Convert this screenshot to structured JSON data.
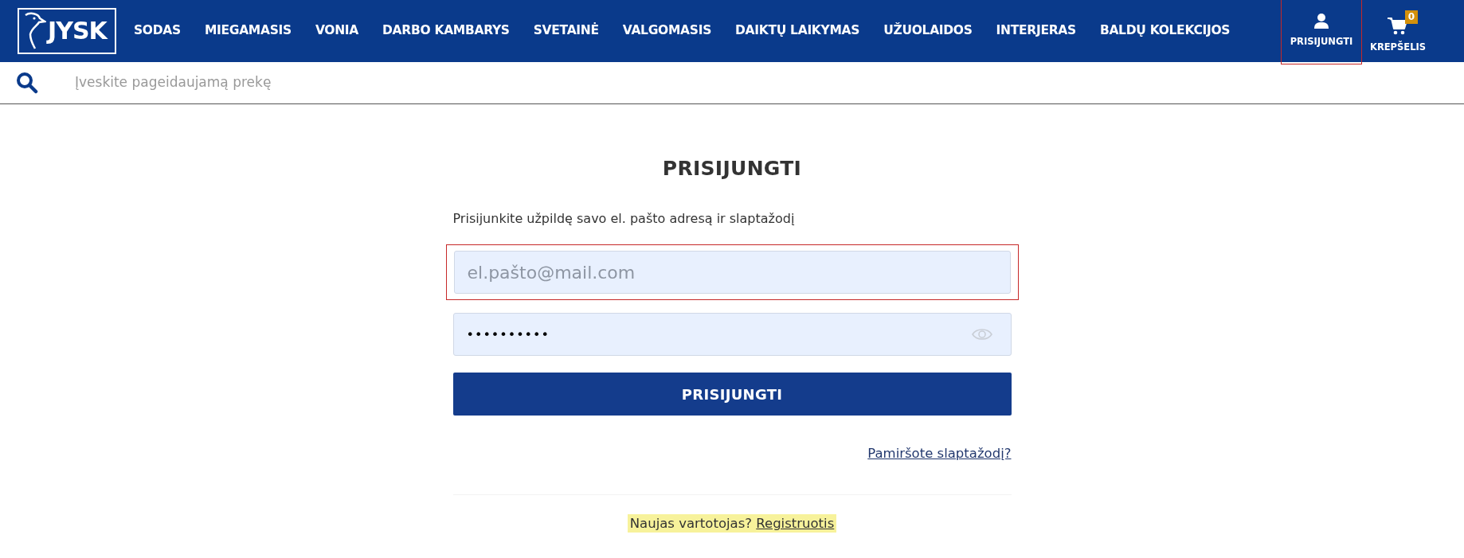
{
  "header": {
    "logo": "JYSK",
    "nav": [
      "SODAS",
      "MIEGAMASIS",
      "VONIA",
      "DARBO KAMBARYS",
      "SVETAINĖ",
      "VALGOMASIS",
      "DAIKTŲ LAIKYMAS",
      "UŽUOLAIDOS",
      "INTERJERAS",
      "BALDŲ KOLEKCIJOS"
    ],
    "account": {
      "label": "PRISIJUNGTI",
      "highlighted": true
    },
    "cart": {
      "label": "KREPŠELIS",
      "count": "0"
    }
  },
  "search": {
    "placeholder": "Įveskite pageidaujamą prekę"
  },
  "login": {
    "title": "PRISIJUNGTI",
    "intro": "Prisijunkite užpildę savo el. pašto adresą ir slaptažodį",
    "email": {
      "placeholder": "el.pašto@mail.com",
      "highlighted": true
    },
    "password": {
      "value": "••••••••••"
    },
    "submit": "PRISIJUNGTI",
    "forgot": "Pamiršote slaptažodį?",
    "register": {
      "text": "Naujas vartotojas?",
      "link": "Registruotis"
    }
  }
}
